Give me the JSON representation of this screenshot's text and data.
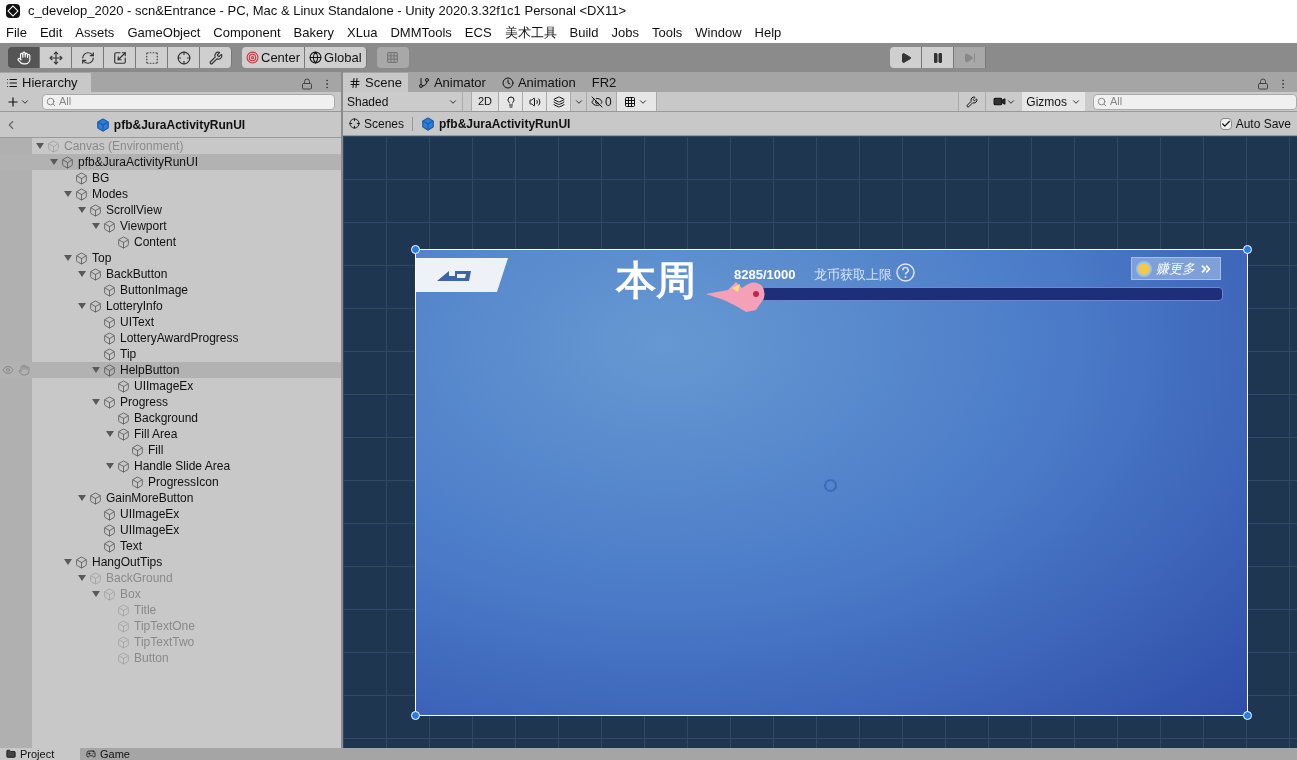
{
  "window": {
    "title": "c_develop_2020 - scn&Entrance - PC, Mac & Linux Standalone - Unity 2020.3.32f1c1 Personal <DX11>"
  },
  "menu": [
    "File",
    "Edit",
    "Assets",
    "GameObject",
    "Component",
    "Bakery",
    "XLua",
    "DMMTools",
    "ECS",
    "美术工具",
    "Build",
    "Jobs",
    "Tools",
    "Window",
    "Help"
  ],
  "toolbar": {
    "tools": [
      {
        "kind": "hand",
        "selected": true
      },
      {
        "kind": "move",
        "selected": false
      },
      {
        "kind": "rotate",
        "selected": false
      },
      {
        "kind": "scale",
        "selected": false
      },
      {
        "kind": "rect",
        "selected": false
      },
      {
        "kind": "transform",
        "selected": false
      },
      {
        "kind": "custom",
        "selected": false
      }
    ],
    "pivot_buttons": [
      "Center",
      "Global"
    ],
    "play_controls": [
      {
        "kind": "play",
        "disabled": false
      },
      {
        "kind": "pause",
        "disabled": false
      },
      {
        "kind": "step",
        "disabled": true
      }
    ]
  },
  "hierarchy": {
    "tab": "Hierarchy",
    "search": {
      "placeholder": "All"
    },
    "breadcrumb": "pfb&JuraActivityRunUI",
    "tree": [
      {
        "label": "Canvas (Environment)",
        "expanded": true,
        "inactive": true,
        "selected": false,
        "children": [
          {
            "label": "pfb&JuraActivityRunUI",
            "expanded": true,
            "inactive": false,
            "selected": true,
            "children": [
              {
                "label": "BG",
                "inactive": false,
                "selected": false
              },
              {
                "label": "Modes",
                "expanded": true,
                "inactive": false,
                "selected": false,
                "children": [
                  {
                    "label": "ScrollView",
                    "expanded": true,
                    "inactive": false,
                    "selected": false,
                    "children": [
                      {
                        "label": "Viewport",
                        "expanded": true,
                        "inactive": false,
                        "selected": false,
                        "children": [
                          {
                            "label": "Content",
                            "inactive": false,
                            "selected": false
                          }
                        ]
                      }
                    ]
                  }
                ]
              },
              {
                "label": "Top",
                "expanded": true,
                "inactive": false,
                "selected": false,
                "children": [
                  {
                    "label": "BackButton",
                    "expanded": true,
                    "inactive": false,
                    "selected": false,
                    "children": [
                      {
                        "label": "ButtonImage",
                        "inactive": false,
                        "selected": false
                      }
                    ]
                  },
                  {
                    "label": "LotteryInfo",
                    "expanded": true,
                    "inactive": false,
                    "selected": false,
                    "children": [
                      {
                        "label": "UIText",
                        "inactive": false,
                        "selected": false
                      },
                      {
                        "label": "LotteryAwardProgress",
                        "inactive": false,
                        "selected": false
                      },
                      {
                        "label": "Tip",
                        "inactive": false,
                        "selected": false
                      },
                      {
                        "label": "HelpButton",
                        "expanded": true,
                        "inactive": false,
                        "selected": true,
                        "children": [
                          {
                            "label": "UIImageEx",
                            "inactive": false,
                            "selected": false
                          }
                        ]
                      },
                      {
                        "label": "Progress",
                        "expanded": true,
                        "inactive": false,
                        "selected": false,
                        "children": [
                          {
                            "label": "Background",
                            "inactive": false,
                            "selected": false
                          },
                          {
                            "label": "Fill Area",
                            "expanded": true,
                            "inactive": false,
                            "selected": false,
                            "children": [
                              {
                                "label": "Fill",
                                "inactive": false,
                                "selected": false
                              }
                            ]
                          },
                          {
                            "label": "Handle Slide Area",
                            "expanded": true,
                            "inactive": false,
                            "selected": false,
                            "children": [
                              {
                                "label": "ProgressIcon",
                                "inactive": false,
                                "selected": false
                              }
                            ]
                          }
                        ]
                      }
                    ]
                  },
                  {
                    "label": "GainMoreButton",
                    "expanded": true,
                    "inactive": false,
                    "selected": false,
                    "children": [
                      {
                        "label": "UIImageEx",
                        "inactive": false,
                        "selected": false
                      },
                      {
                        "label": "UIImageEx",
                        "inactive": false,
                        "selected": false
                      },
                      {
                        "label": "Text",
                        "inactive": false,
                        "selected": false
                      }
                    ]
                  }
                ]
              },
              {
                "label": "HangOutTips",
                "expanded": true,
                "inactive": false,
                "selected": false,
                "children": [
                  {
                    "label": "BackGround",
                    "expanded": true,
                    "inactive": true,
                    "selected": false,
                    "children": [
                      {
                        "label": "Box",
                        "expanded": true,
                        "inactive": true,
                        "selected": false,
                        "children": [
                          {
                            "label": "Title",
                            "inactive": true,
                            "selected": false
                          },
                          {
                            "label": "TipTextOne",
                            "inactive": true,
                            "selected": false
                          },
                          {
                            "label": "TipTextTwo",
                            "inactive": true,
                            "selected": false
                          },
                          {
                            "label": "Button",
                            "inactive": true,
                            "selected": false
                          }
                        ]
                      }
                    ]
                  }
                ]
              }
            ]
          }
        ]
      }
    ]
  },
  "scene": {
    "tabs": [
      {
        "label": "Scene",
        "kind": "scene",
        "selected": true
      },
      {
        "label": "Animator",
        "kind": "animator",
        "selected": false
      },
      {
        "label": "Animation",
        "kind": "animation",
        "selected": false
      },
      {
        "label": "FR2",
        "kind": "plain",
        "selected": false
      }
    ],
    "shading": "Shaded",
    "mode_2d": {
      "label": "2D",
      "selected": true
    },
    "toggles": [
      {
        "kind": "lighting",
        "on": true
      },
      {
        "kind": "audio",
        "on": true
      },
      {
        "kind": "effects",
        "on": true
      }
    ],
    "grid_on": true,
    "hidden_count": "0",
    "gizmos": "Gizmos",
    "search": {
      "placeholder": "All"
    },
    "breadcrumbs": [
      "Scenes",
      "pfb&JuraActivityRunUI"
    ],
    "auto_save": {
      "label": "Auto Save",
      "checked": true
    },
    "game": {
      "title": "本周",
      "count": "8285/1000",
      "limit_label": "龙币获取上限",
      "progress": {
        "level": 0
      },
      "gain_more": "赚更多"
    }
  },
  "bottom_tabs": [
    {
      "label": "Project",
      "selected": true
    },
    {
      "label": "Game",
      "selected": false
    }
  ]
}
